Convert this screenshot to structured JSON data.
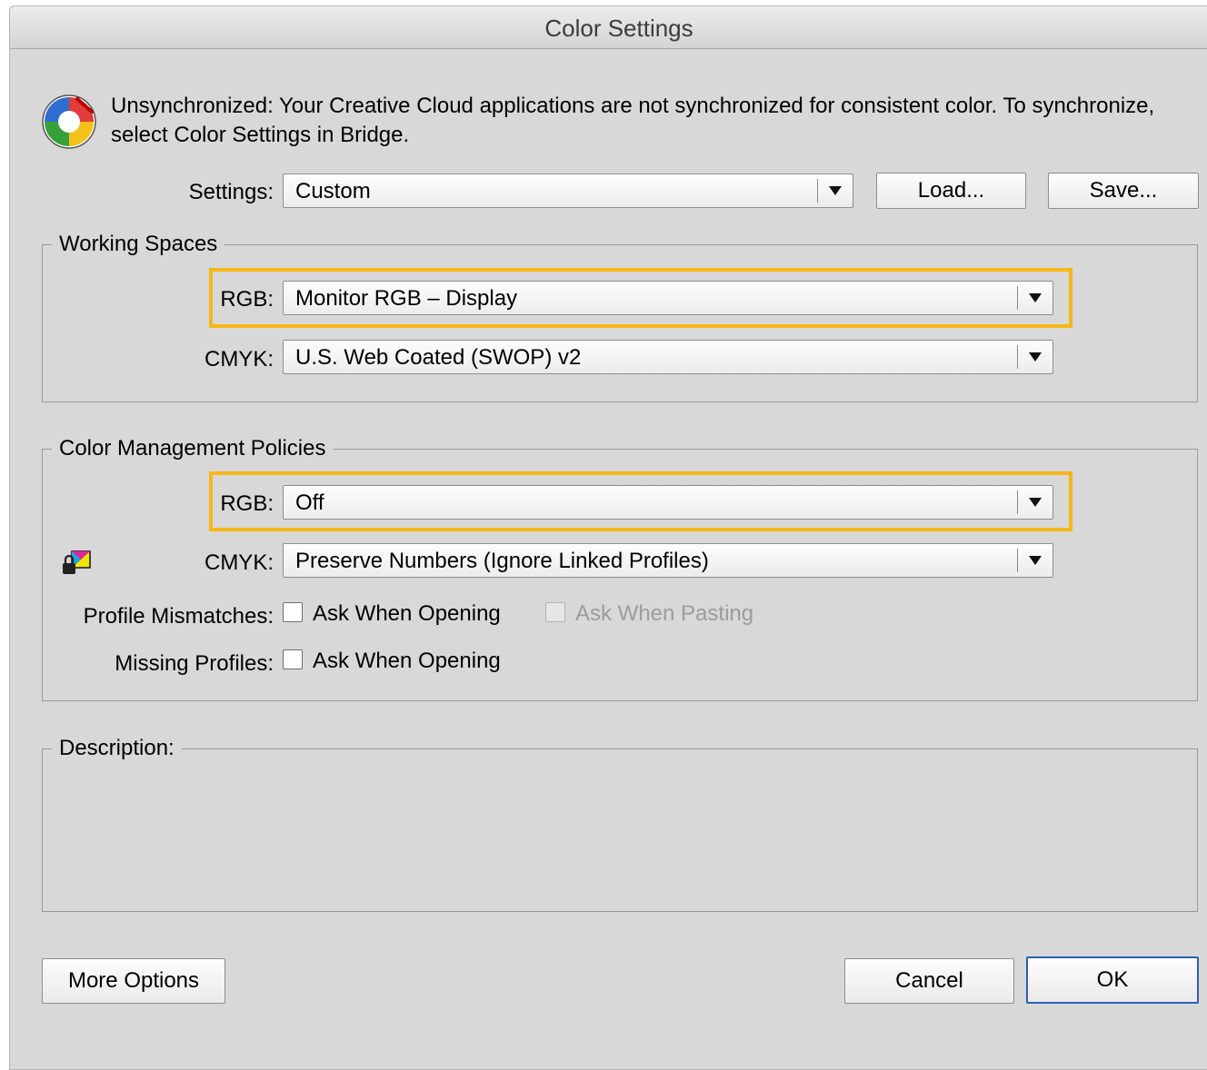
{
  "window": {
    "title": "Color Settings"
  },
  "sync_message": "Unsynchronized: Your Creative Cloud applications are not synchronized for consistent color. To synchronize, select Color Settings in Bridge.",
  "settings": {
    "label": "Settings:",
    "value": "Custom",
    "load_label": "Load...",
    "save_label": "Save..."
  },
  "working_spaces": {
    "title": "Working Spaces",
    "rgb_label": "RGB:",
    "rgb_value": "Monitor RGB – Display",
    "cmyk_label": "CMYK:",
    "cmyk_value": "U.S. Web Coated (SWOP) v2"
  },
  "policies": {
    "title": "Color Management Policies",
    "rgb_label": "RGB:",
    "rgb_value": "Off",
    "cmyk_label": "CMYK:",
    "cmyk_value": "Preserve Numbers (Ignore Linked Profiles)",
    "profile_mismatches_label": "Profile Mismatches:",
    "ask_when_opening_label": "Ask When Opening",
    "ask_when_pasting_label": "Ask When Pasting",
    "missing_profiles_label": "Missing Profiles:",
    "missing_ask_when_opening_label": "Ask When Opening",
    "ask_when_opening_checked": false,
    "ask_when_pasting_checked": false,
    "ask_when_pasting_enabled": false,
    "missing_ask_when_opening_checked": false
  },
  "description": {
    "title": "Description:"
  },
  "buttons": {
    "more_options": "More Options",
    "cancel": "Cancel",
    "ok": "OK"
  },
  "colors": {
    "highlight": "#f6b818",
    "dialog_bg": "#d8d8d8",
    "default_button_border": "#2d5fb4"
  }
}
